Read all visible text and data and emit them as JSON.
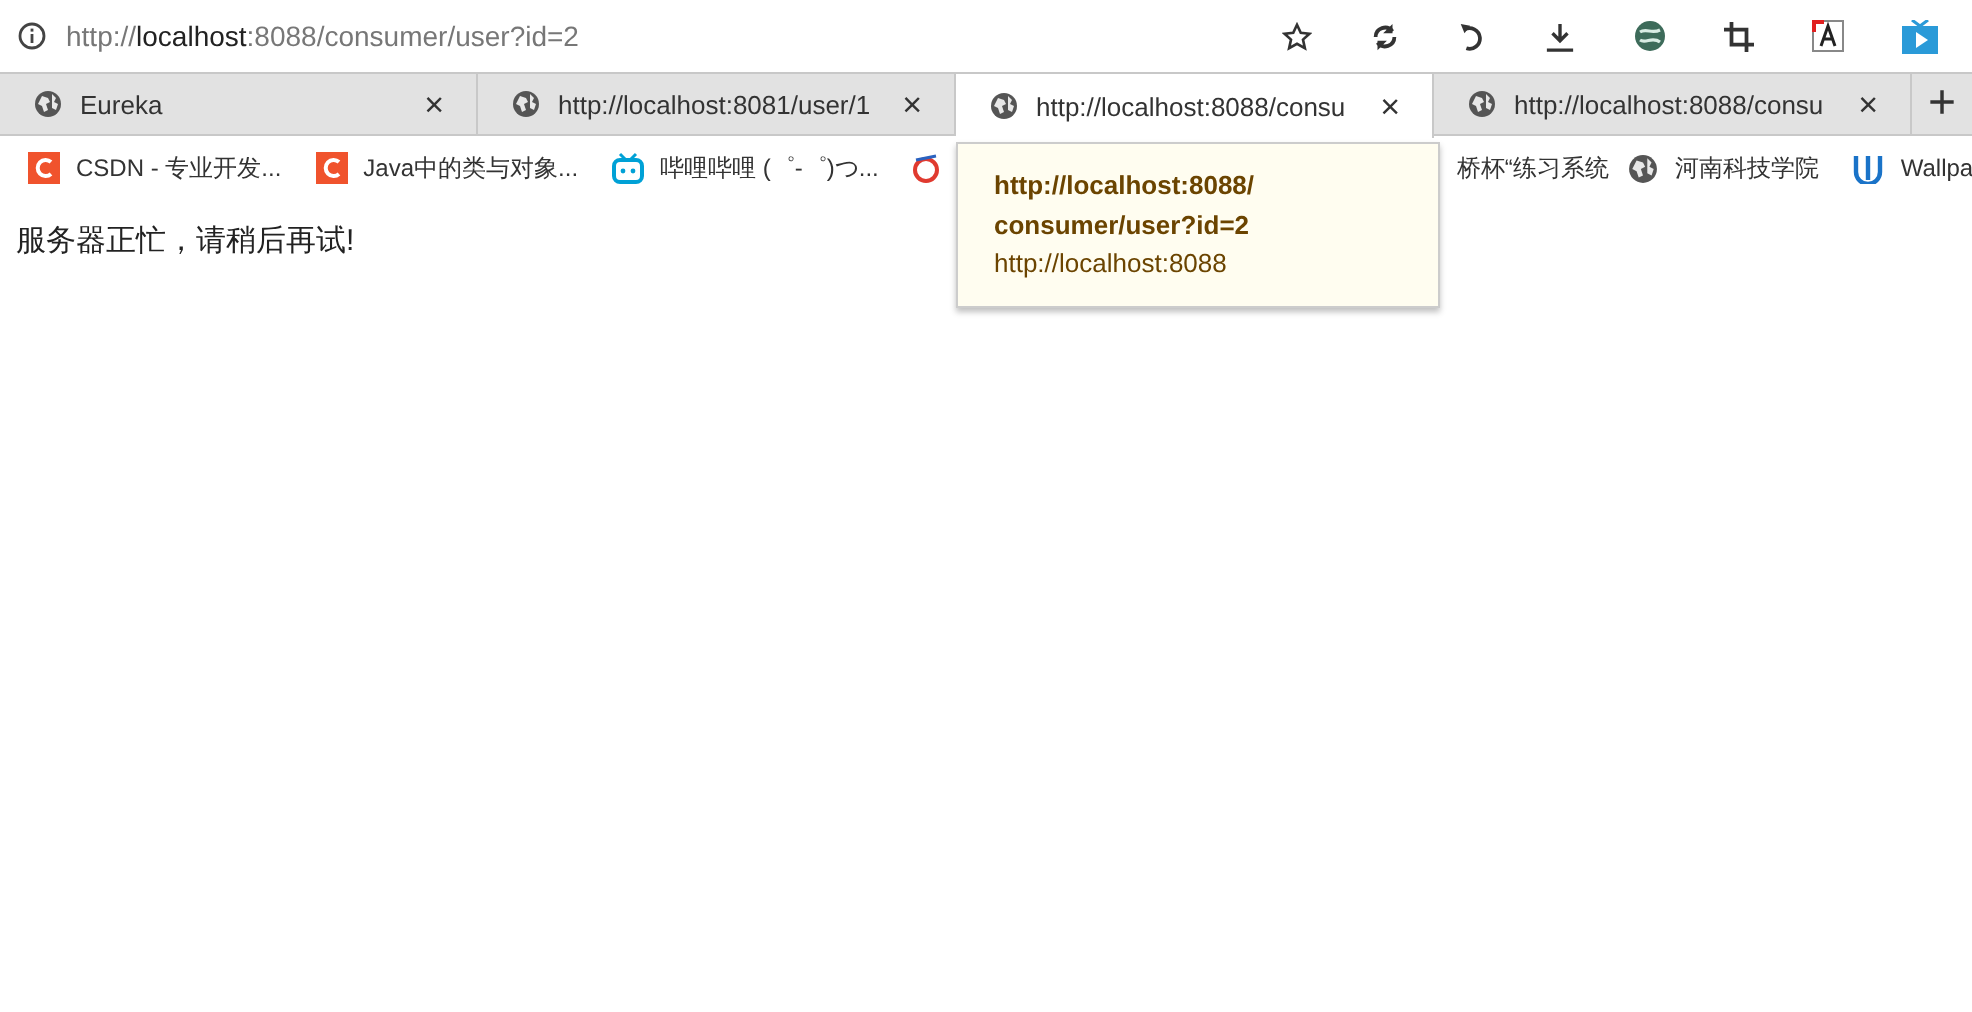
{
  "address_bar": {
    "url_parts": [
      {
        "text": "http://",
        "emphasis": false
      },
      {
        "text": "localhost",
        "emphasis": true
      },
      {
        "text": ":8088/consumer/user?id=2",
        "emphasis": false
      }
    ]
  },
  "tabs": [
    {
      "label": "Eureka",
      "selected": false,
      "close": "×"
    },
    {
      "label": "http://localhost:8081/user/1",
      "selected": false,
      "close": "×"
    },
    {
      "label": "http://localhost:8088/consu",
      "selected": true,
      "close": "×"
    },
    {
      "label": "http://localhost:8088/consu",
      "selected": false,
      "close": "×"
    }
  ],
  "new_tab": "+",
  "bookmarks": [
    {
      "kind": "csdn",
      "label": "CSDN - 专业开发..."
    },
    {
      "kind": "csdn",
      "label": "Java中的类与对象..."
    },
    {
      "kind": "bilibili",
      "label": "哔哩哔哩 (゜-゜)つ..."
    },
    {
      "kind": "ie",
      "label": "桥杯“练习系统"
    },
    {
      "kind": "globe",
      "label": "河南科技学院"
    },
    {
      "kind": "w",
      "label": "Wallpa"
    }
  ],
  "page": {
    "message": "服务器正忙，请稍后再试!"
  },
  "tooltip": {
    "title_lines": [
      "http://localhost:8088/",
      "consumer/user?id=2"
    ],
    "subtitle": "http://localhost:8088"
  }
}
